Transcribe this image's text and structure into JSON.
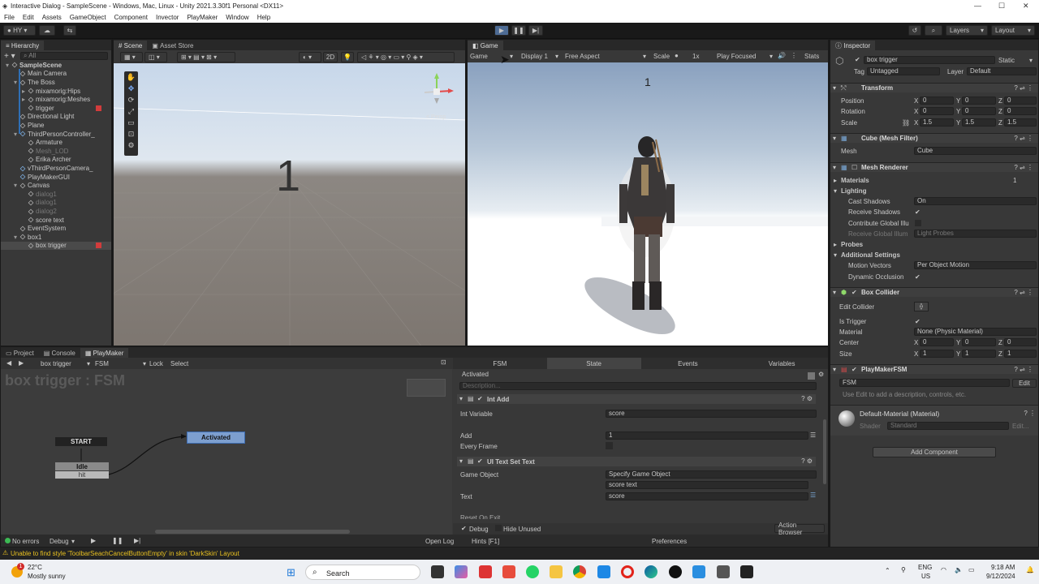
{
  "window": {
    "title": "Interactive Dialog - SampleScene - Windows, Mac, Linux - Unity 2021.3.30f1 Personal <DX11>",
    "min": "—",
    "max": "☐",
    "close": "✕"
  },
  "menu": [
    "File",
    "Edit",
    "Assets",
    "GameObject",
    "Component",
    "Invector",
    "PlayMaker",
    "Window",
    "Help"
  ],
  "toolbar": {
    "account": "HY",
    "layers": "Layers",
    "layout": "Layout"
  },
  "hierarchy": {
    "tab": "Hierarchy",
    "search_placeholder": "All",
    "items": [
      {
        "label": "SampleScene",
        "indent": 0
      },
      {
        "label": "Main Camera",
        "indent": 1
      },
      {
        "label": "The Boss",
        "indent": 1
      },
      {
        "label": "mixamorig:Hips",
        "indent": 2
      },
      {
        "label": "mixamorig:Meshes",
        "indent": 2
      },
      {
        "label": "trigger",
        "indent": 2
      },
      {
        "label": "Directional Light",
        "indent": 1
      },
      {
        "label": "Plane",
        "indent": 1
      },
      {
        "label": "ThirdPersonController_",
        "indent": 1
      },
      {
        "label": "Armature",
        "indent": 2
      },
      {
        "label": "Mesh_LOD",
        "indent": 2
      },
      {
        "label": "Erika Archer",
        "indent": 2
      },
      {
        "label": "vThirdPersonCamera_",
        "indent": 1
      },
      {
        "label": "PlayMakerGUI",
        "indent": 1
      },
      {
        "label": "Canvas",
        "indent": 1
      },
      {
        "label": "dialog1",
        "indent": 2
      },
      {
        "label": "dialog1",
        "indent": 2
      },
      {
        "label": "dialog2",
        "indent": 2
      },
      {
        "label": "score text",
        "indent": 2
      },
      {
        "label": "EventSystem",
        "indent": 1
      },
      {
        "label": "box1",
        "indent": 1
      },
      {
        "label": "box trigger",
        "indent": 2
      }
    ]
  },
  "scene": {
    "tab": "Scene",
    "tab2": "Asset Store",
    "mode2d": "2D",
    "persp": "< Persp",
    "big_number": "1"
  },
  "game": {
    "tab": "Game",
    "mode": "Game",
    "display": "Display 1",
    "aspect": "Free Aspect",
    "scale_label": "Scale",
    "scale_value": "1x",
    "play_focused": "Play Focused",
    "stats": "Stats",
    "number": "1"
  },
  "inspector": {
    "tab": "Inspector",
    "object": "box trigger",
    "static": "Static",
    "tag_label": "Tag",
    "tag": "Untagged",
    "layer_label": "Layer",
    "layer": "Default",
    "transform": {
      "title": "Transform",
      "position": [
        "0",
        "0",
        "0"
      ],
      "rotation": [
        "0",
        "0",
        "0"
      ],
      "scale": [
        "1.5",
        "1.5",
        "1.5"
      ],
      "lbl_pos": "Position",
      "lbl_rot": "Rotation",
      "lbl_scale": "Scale"
    },
    "meshfilter": {
      "title": "Cube (Mesh Filter)",
      "mesh_label": "Mesh",
      "mesh": "Cube"
    },
    "renderer": {
      "title": "Mesh Renderer",
      "materials": "Materials",
      "materials_count": "1",
      "lighting": "Lighting",
      "cast_shadows": "Cast Shadows",
      "cast_value": "On",
      "receive_shadows": "Receive Shadows",
      "contribute": "Contribute Global Illu",
      "receive_gi": "Receive Global Illum",
      "receive_gi_value": "Light Probes",
      "probes": "Probes",
      "additional": "Additional Settings",
      "motion": "Motion Vectors",
      "motion_value": "Per Object Motion",
      "dynamic": "Dynamic Occlusion"
    },
    "collider": {
      "title": "Box Collider",
      "edit": "Edit Collider",
      "is_trigger": "Is Trigger",
      "material_label": "Material",
      "material": "None (Physic Material)",
      "center_label": "Center",
      "center": [
        "0",
        "0",
        "0"
      ],
      "size_label": "Size",
      "size": [
        "1",
        "1",
        "1"
      ]
    },
    "fsm": {
      "title": "PlayMakerFSM",
      "fsm": "FSM",
      "edit": "Edit",
      "desc": "Use Edit to add a description, controls, etc."
    },
    "material": {
      "name": "Default-Material (Material)",
      "shader_label": "Shader",
      "shader": "Standard",
      "edit": "Edit..."
    },
    "add_component": "Add Component"
  },
  "bottom": {
    "tabs": [
      "Project",
      "Console",
      "PlayMaker"
    ],
    "object": "box trigger",
    "fsm": "FSM",
    "lock": "Lock",
    "select": "Select",
    "graph_title": "box trigger : FSM",
    "start": "START",
    "idle": "Idle",
    "hit": "hit",
    "activated": "Activated",
    "status_errors": "No errors",
    "debug": "Debug",
    "right_tabs": [
      "FSM",
      "State",
      "Events",
      "Variables"
    ],
    "state_name": "Activated",
    "description": "Description...",
    "action1": {
      "title": "Int Add",
      "int_variable": "Int Variable",
      "var_value": "score",
      "add": "Add",
      "add_value": "1",
      "every_frame": "Every Frame"
    },
    "action2": {
      "title": "UI Text Set Text",
      "go": "Game Object",
      "go_value": "Specify Game Object",
      "go_obj": "score text",
      "text": "Text",
      "text_value": "score",
      "reset": "Reset On Exit"
    },
    "footer": {
      "debug": "Debug",
      "hide_unused": "Hide Unused",
      "action_browser": "Action Browser",
      "open_log": "Open Log",
      "hints": "Hints [F1]",
      "preferences": "Preferences"
    }
  },
  "statusbar": {
    "warning": "Unable to find style 'ToolbarSeachCancelButtonEmpty' in skin 'DarkSkin' Layout"
  },
  "taskbar": {
    "temp": "22°C",
    "weather": "Mostly sunny",
    "search": "Search",
    "lang1": "ENG",
    "lang2": "US",
    "time": "9:18 AM",
    "date": "9/12/2024",
    "badge": "1"
  }
}
